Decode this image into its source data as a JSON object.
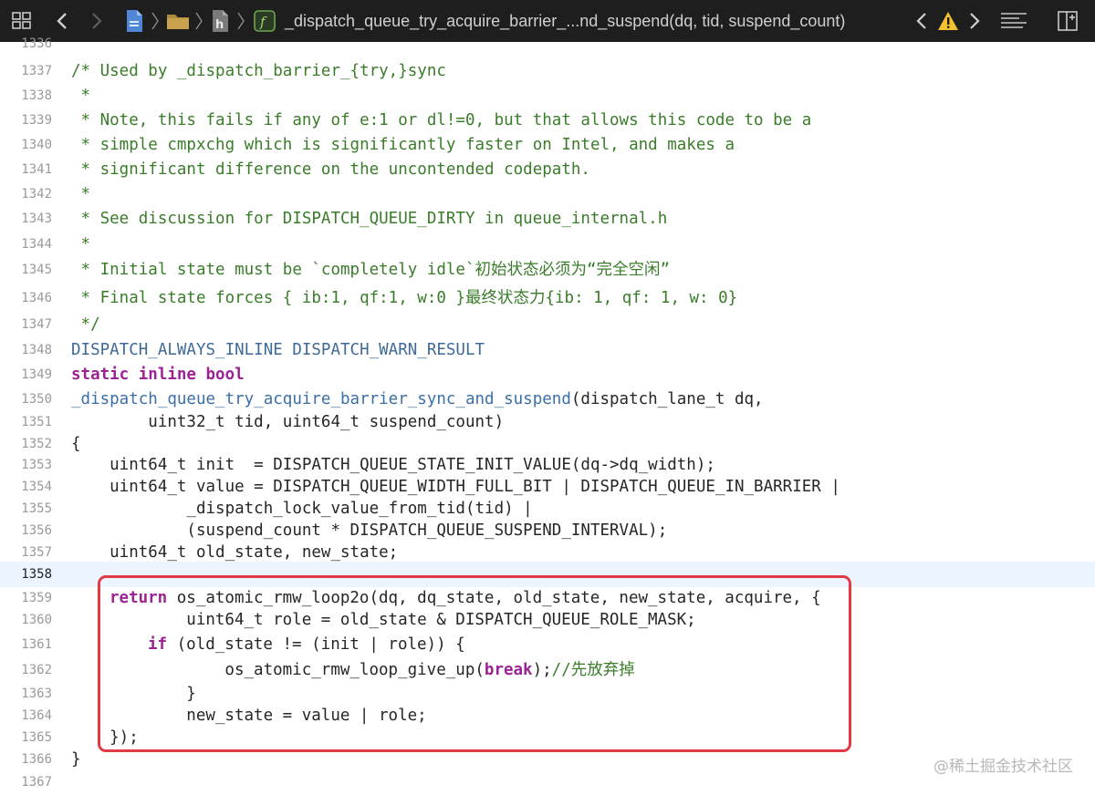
{
  "toolbar": {
    "breadcrumb_title": "_dispatch_queue_try_acquire_barrier_...nd_suspend(dq, tid, suspend_count)",
    "icons": [
      "grid-icon",
      "back-chevron-icon",
      "forward-chevron-icon",
      "file-icon",
      "folder-icon",
      "header-file-icon",
      "function-icon",
      "issue-prev-icon",
      "warning-icon",
      "issue-next-icon",
      "minimap-icon",
      "add-editor-icon"
    ]
  },
  "editor": {
    "current_line": "1358",
    "lines": [
      {
        "no": "1336",
        "text": ""
      },
      {
        "no": "1337",
        "text": "/* Used by _dispatch_barrier_{try,}sync"
      },
      {
        "no": "1338",
        "text": " *"
      },
      {
        "no": "1339",
        "text": " * Note, this fails if any of e:1 or dl!=0, but that allows this code to be a"
      },
      {
        "no": "1340",
        "text": " * simple cmpxchg which is significantly faster on Intel, and makes a"
      },
      {
        "no": "1341",
        "text": " * significant difference on the uncontended codepath."
      },
      {
        "no": "1342",
        "text": " *"
      },
      {
        "no": "1343",
        "text": " * See discussion for DISPATCH_QUEUE_DIRTY in queue_internal.h"
      },
      {
        "no": "1344",
        "text": " *"
      },
      {
        "no": "1345",
        "text": " * Initial state must be `completely idle`初始状态必须为“完全空闲”"
      },
      {
        "no": "1346",
        "text": " * Final state forces { ib:1, qf:1, w:0 }最终状态力{ib: 1, qf: 1, w: 0}"
      },
      {
        "no": "1347",
        "text": " */"
      },
      {
        "no": "1348",
        "text": "DISPATCH_ALWAYS_INLINE DISPATCH_WARN_RESULT"
      },
      {
        "no": "1349",
        "kw": "static inline bool"
      },
      {
        "no": "1350",
        "fn": "_dispatch_queue_try_acquire_barrier_sync_and_suspend",
        "rest": "(dispatch_lane_t dq,"
      },
      {
        "no": "1351",
        "text": "        uint32_t tid, uint64_t suspend_count)"
      },
      {
        "no": "1352",
        "text": "{"
      },
      {
        "no": "1353",
        "text": "    uint64_t init  = DISPATCH_QUEUE_STATE_INIT_VALUE(dq->dq_width);"
      },
      {
        "no": "1354",
        "text": "    uint64_t value = DISPATCH_QUEUE_WIDTH_FULL_BIT | DISPATCH_QUEUE_IN_BARRIER |"
      },
      {
        "no": "1355",
        "text": "            _dispatch_lock_value_from_tid(tid) |"
      },
      {
        "no": "1356",
        "text": "            (suspend_count * DISPATCH_QUEUE_SUSPEND_INTERVAL);"
      },
      {
        "no": "1357",
        "text": "    uint64_t old_state, new_state;"
      },
      {
        "no": "1358",
        "text": ""
      },
      {
        "no": "1359",
        "kw": "return",
        "rest": " os_atomic_rmw_loop2o(dq, dq_state, old_state, new_state, acquire, {"
      },
      {
        "no": "1360",
        "text": "        uint64_t role = old_state & DISPATCH_QUEUE_ROLE_MASK;"
      },
      {
        "no": "1361",
        "kw": "if",
        "rest": " (old_state != (init | role)) {"
      },
      {
        "no": "1362",
        "pre": "            os_atomic_rmw_loop_give_up(",
        "kw": "break",
        "rest": ");",
        "cm": "//先放弃掉"
      },
      {
        "no": "1363",
        "text": "        }"
      },
      {
        "no": "1364",
        "text": "        new_state = value | role;"
      },
      {
        "no": "1365",
        "text": "    });"
      },
      {
        "no": "1366",
        "text": "}"
      },
      {
        "no": "1367",
        "text": ""
      }
    ]
  },
  "watermark": "@稀土掘金技术社区"
}
